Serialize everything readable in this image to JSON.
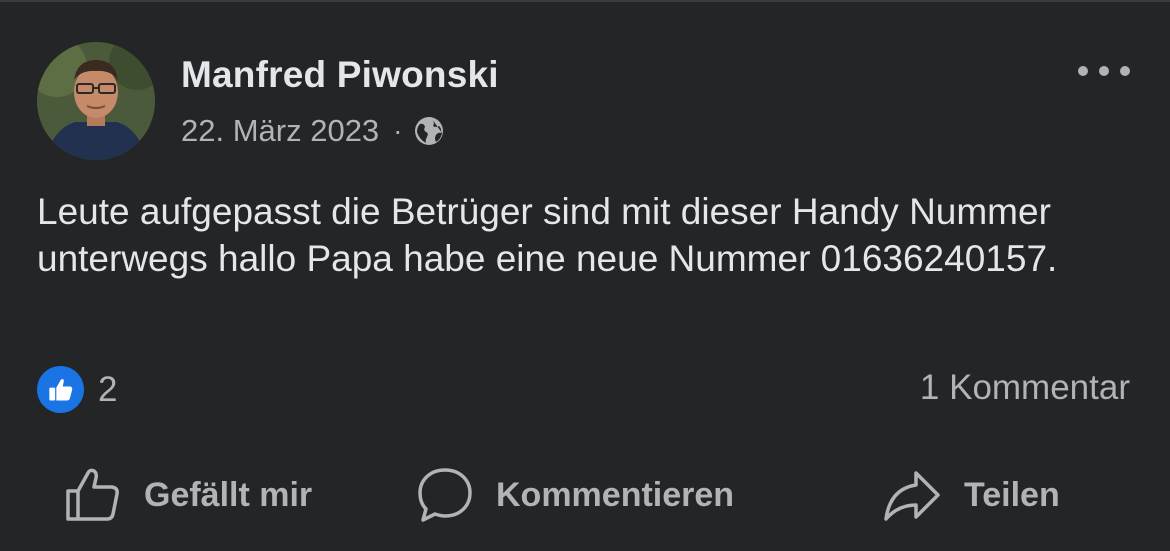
{
  "post": {
    "author": "Manfred Piwonski",
    "date": "22. März 2023",
    "separator": "·",
    "privacy_icon": "globe-icon",
    "text": "Leute aufgepasst die Betrüger sind mit dieser Handy Nummer unterwegs hallo Papa habe eine neue Nummer 01636240157.",
    "reactions": {
      "icon": "thumbs-up-icon",
      "count": "2"
    },
    "comment_count": "1 Kommentar"
  },
  "actions": {
    "like_label": "Gefällt mir",
    "comment_label": "Kommentieren",
    "share_label": "Teilen"
  },
  "colors": {
    "background": "#242526",
    "primary_text": "#e4e6eb",
    "secondary_text": "#b0b3b8",
    "like_blue": "#1b74e4"
  }
}
